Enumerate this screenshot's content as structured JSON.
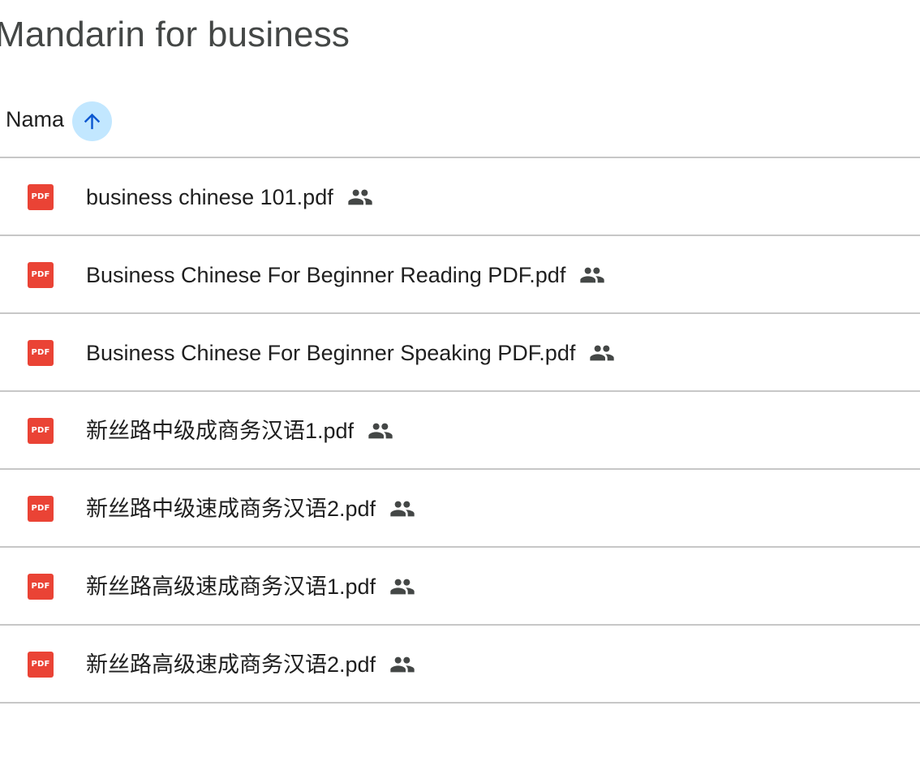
{
  "folder": {
    "title": "Mandarin for business"
  },
  "list_header": {
    "name_column": "Nama",
    "sort_icon": "arrow-upward-icon"
  },
  "colors": {
    "pdf_icon": "#ea4335",
    "sort_button_bg": "#c2e7ff",
    "sort_arrow": "#0b57d0",
    "divider": "#c7c7c7"
  },
  "files": [
    {
      "name": "business chinese 101.pdf",
      "type_icon": "pdf-icon",
      "type_label": "PDF",
      "shared_icon": "people-icon"
    },
    {
      "name": "Business Chinese For Beginner Reading PDF.pdf",
      "type_icon": "pdf-icon",
      "type_label": "PDF",
      "shared_icon": "people-icon"
    },
    {
      "name": "Business Chinese For Beginner Speaking PDF.pdf",
      "type_icon": "pdf-icon",
      "type_label": "PDF",
      "shared_icon": "people-icon"
    },
    {
      "name": "新丝路中级成商务汉语1.pdf",
      "type_icon": "pdf-icon",
      "type_label": "PDF",
      "shared_icon": "people-icon"
    },
    {
      "name": "新丝路中级速成商务汉语2.pdf",
      "type_icon": "pdf-icon",
      "type_label": "PDF",
      "shared_icon": "people-icon"
    },
    {
      "name": "新丝路高级速成商务汉语1.pdf",
      "type_icon": "pdf-icon",
      "type_label": "PDF",
      "shared_icon": "people-icon"
    },
    {
      "name": "新丝路高级速成商务汉语2.pdf",
      "type_icon": "pdf-icon",
      "type_label": "PDF",
      "shared_icon": "people-icon"
    }
  ]
}
